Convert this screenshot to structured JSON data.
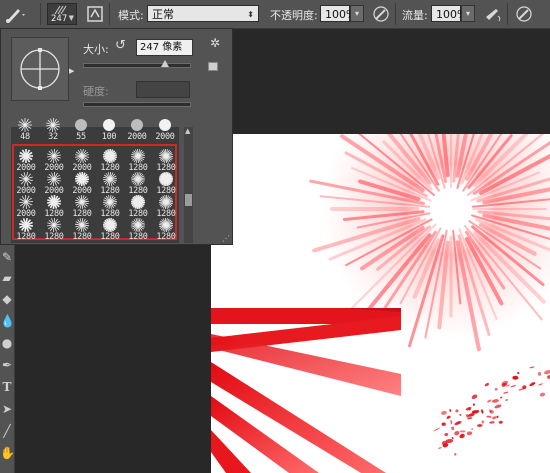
{
  "options_bar": {
    "brush_size": "247",
    "mode_label": "模式:",
    "mode_value": "正常",
    "opacity_label": "不透明度:",
    "opacity_value": "100%",
    "flow_label": "流量:",
    "flow_value": "100%"
  },
  "brush_panel": {
    "size_label": "大小:",
    "size_value": "247 像素",
    "hardness_label": "硬度:",
    "top_row_numbers": [
      "48",
      "32",
      "55",
      "100",
      "2000",
      "2000"
    ],
    "presets": [
      [
        "2000",
        "2000",
        "2000",
        "1280",
        "1280",
        "1280"
      ],
      [
        "2000",
        "2000",
        "2000",
        "1280",
        "1280",
        "1280"
      ],
      [
        "2000",
        "1280",
        "1280",
        "1280",
        "1280",
        "1280"
      ],
      [
        "1280",
        "1280",
        "1280",
        "1280",
        "1280",
        "1280"
      ]
    ]
  },
  "colors": {
    "highlight_border": "#cc2a2a",
    "brush_red": "#e0141a"
  }
}
